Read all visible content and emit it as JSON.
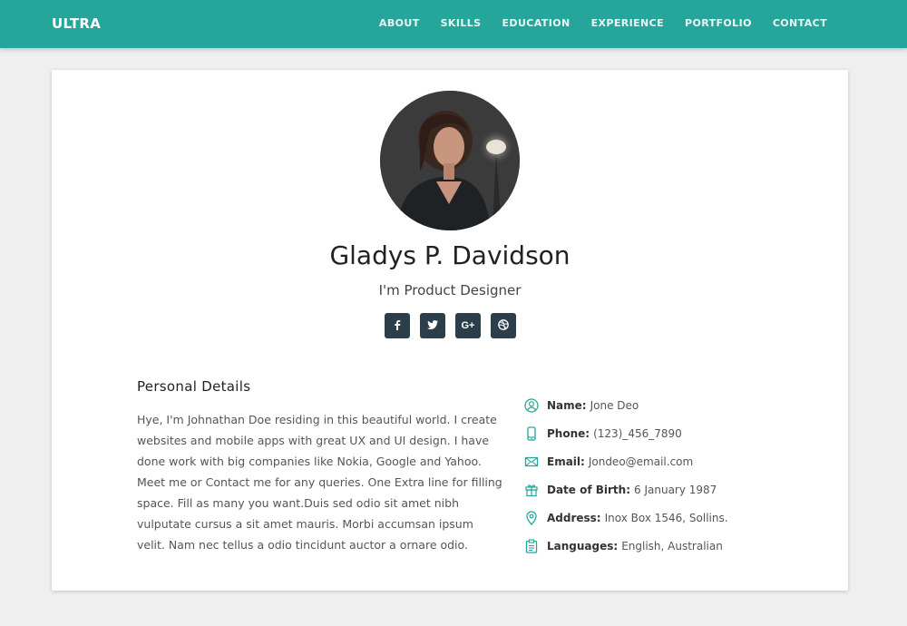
{
  "navbar": {
    "brand": "ULTRA",
    "links": [
      "ABOUT",
      "SKILLS",
      "EDUCATION",
      "EXPERIENCE",
      "PORTFOLIO",
      "CONTACT"
    ]
  },
  "profile": {
    "name": "Gladys P. Davidson",
    "role": "I'm Product Designer",
    "socials": [
      {
        "icon": "facebook-icon",
        "glyph": "f"
      },
      {
        "icon": "twitter-icon",
        "glyph": "t"
      },
      {
        "icon": "google-plus-icon",
        "glyph": "G+"
      },
      {
        "icon": "dribbble-icon",
        "glyph": "dribbble"
      }
    ]
  },
  "personal": {
    "title": "Personal Details",
    "bio": "Hye, I'm Johnathan Doe residing in this beautiful world. I create websites and mobile apps with great UX and UI design. I have done work with big companies like Nokia, Google and Yahoo. Meet me or Contact me for any queries. One Extra line for filling space. Fill as many you want.Duis sed odio sit amet nibh vulputate cursus a sit amet mauris. Morbi accumsan ipsum velit. Nam nec tellus a odio tincidunt auctor a ornare odio."
  },
  "details": [
    {
      "icon": "user-icon",
      "label": "Name:",
      "value": "Jone Deo"
    },
    {
      "icon": "phone-icon",
      "label": "Phone:",
      "value": "(123)_456_7890"
    },
    {
      "icon": "email-icon",
      "label": "Email:",
      "value": "Jondeo@email.com"
    },
    {
      "icon": "gift-icon",
      "label": "Date of Birth:",
      "value": "6 January 1987"
    },
    {
      "icon": "map-pin-icon",
      "label": "Address:",
      "value": "Inox Box 1546, Sollins."
    },
    {
      "icon": "clipboard-icon",
      "label": "Languages:",
      "value": "English, Australian"
    }
  ],
  "colors": {
    "accent": "#26a69a",
    "social_bg": "#2c3e4a",
    "icon": "#26a69a"
  }
}
